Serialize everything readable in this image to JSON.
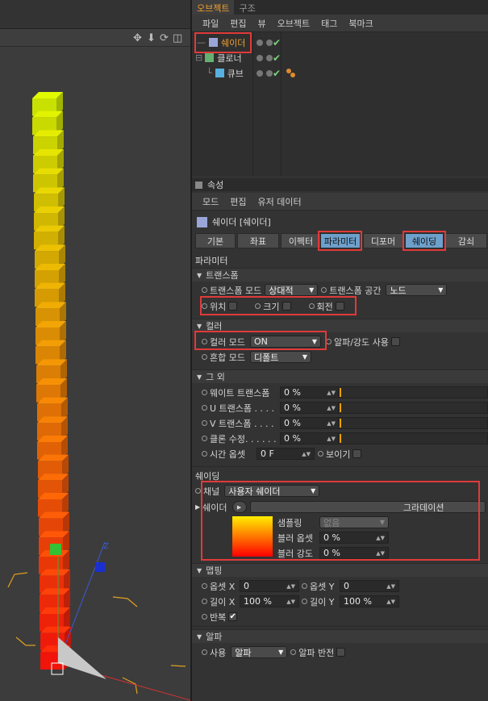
{
  "object_manager": {
    "tabs": [
      "오브젝트",
      "구조"
    ],
    "menu": [
      "파일",
      "편집",
      "뷰",
      "오브젝트",
      "태그",
      "북마크"
    ],
    "objects": [
      "쉐이더",
      "클로너",
      "큐브"
    ]
  },
  "attributes": {
    "title": "속성",
    "menu": [
      "모드",
      "편집",
      "유저 데이터"
    ],
    "object_name": "쉐이더 [쉐이더]",
    "tabs": [
      "기본",
      "좌표",
      "이펙터",
      "파라미터",
      "디포머",
      "쉐이딩",
      "감쇠"
    ],
    "section_parameters": "파라미터",
    "transform": {
      "header": "트랜스폼",
      "mode_label": "트랜스폼 모드",
      "mode_value": "상대적",
      "space_label": "트랜스폼 공간",
      "space_value": "노드",
      "position": "위치",
      "scale": "크기",
      "rotation": "회전"
    },
    "color": {
      "header": "컬러",
      "mode_label": "컬러 모드",
      "mode_value": "ON",
      "alpha_label": "알파/강도 사용",
      "blend_label": "혼합 모드",
      "blend_value": "디폴트"
    },
    "other": {
      "header": "그 외",
      "weight_label": "웨이트 트랜스폼",
      "weight_value": "0 %",
      "u_label": "U 트랜스폼 . . . .",
      "u_value": "0 %",
      "v_label": "V 트랜스폼 . . . .",
      "v_value": "0 %",
      "clone_label": "클론 수정. . . . . .",
      "clone_value": "0 %",
      "time_label": "시간 옵셋",
      "time_value": "0 F",
      "visible_label": "보이기"
    },
    "shading": {
      "header": "쉐이딩",
      "channel_label": "채널",
      "channel_value": "사용자 쉐이더",
      "shader_label": "쉐이더",
      "shader_value": "그라데이션",
      "sampling_label": "샘플링",
      "sampling_value": "없음",
      "blur_offset_label": "블러 옵셋",
      "blur_offset_value": "0 %",
      "blur_strength_label": "블러 강도",
      "blur_strength_value": "0 %"
    },
    "mapping": {
      "header": "맵핑",
      "offset_x_label": "옵셋 X",
      "offset_x_value": "0",
      "offset_y_label": "옵셋 Y",
      "offset_y_value": "0",
      "length_x_label": "길이 X",
      "length_x_value": "100 %",
      "length_y_label": "길이 Y",
      "length_y_value": "100 %",
      "repeat_label": "반복"
    },
    "alpha": {
      "header": "알파",
      "use_label": "사용",
      "use_value": "알파",
      "invert_label": "알파 반전"
    }
  },
  "colors": {
    "highlight_box": "#e03a3a",
    "active_tab": "#6ea0cc",
    "gradient_start": "#ffee00",
    "gradient_end": "#ff0000"
  }
}
